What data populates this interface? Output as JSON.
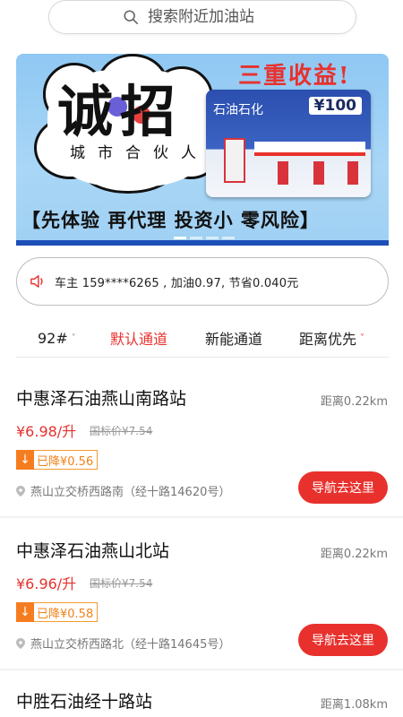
{
  "search": {
    "placeholder": "搜索附近加油站"
  },
  "banner": {
    "title": "诚招",
    "subtitle": "城市合伙人",
    "promo": "三重收益!",
    "card_brand": "石油石化",
    "card_amount": "¥100",
    "slogan": "【先体验 再代理 投资小 零风险】"
  },
  "notice": {
    "text": "车主 159****6265 , 加油0.97, 节省0.040元"
  },
  "filters": {
    "fuel": "92#",
    "default_channel": "默认通道",
    "new_energy": "新能通道",
    "distance_first": "距离优先"
  },
  "stations": [
    {
      "name": "中惠泽石油燕山南路站",
      "distance": "距离0.22km",
      "price": "¥6.98/升",
      "reference_price": "国标价¥7.54",
      "discount": "已降¥0.56",
      "address": "燕山立交桥西路南（经十路14620号）",
      "nav_label": "导航去这里"
    },
    {
      "name": "中惠泽石油燕山北站",
      "distance": "距离0.22km",
      "price": "¥6.96/升",
      "reference_price": "国标价¥7.54",
      "discount": "已降¥0.58",
      "address": "燕山立交桥西路北（经十路14645号）",
      "nav_label": "导航去这里"
    },
    {
      "name": "中胜石油经十路站",
      "distance": "距离1.08km"
    }
  ],
  "colors": {
    "accent": "#e8312d",
    "discount": "#f57c1f"
  }
}
